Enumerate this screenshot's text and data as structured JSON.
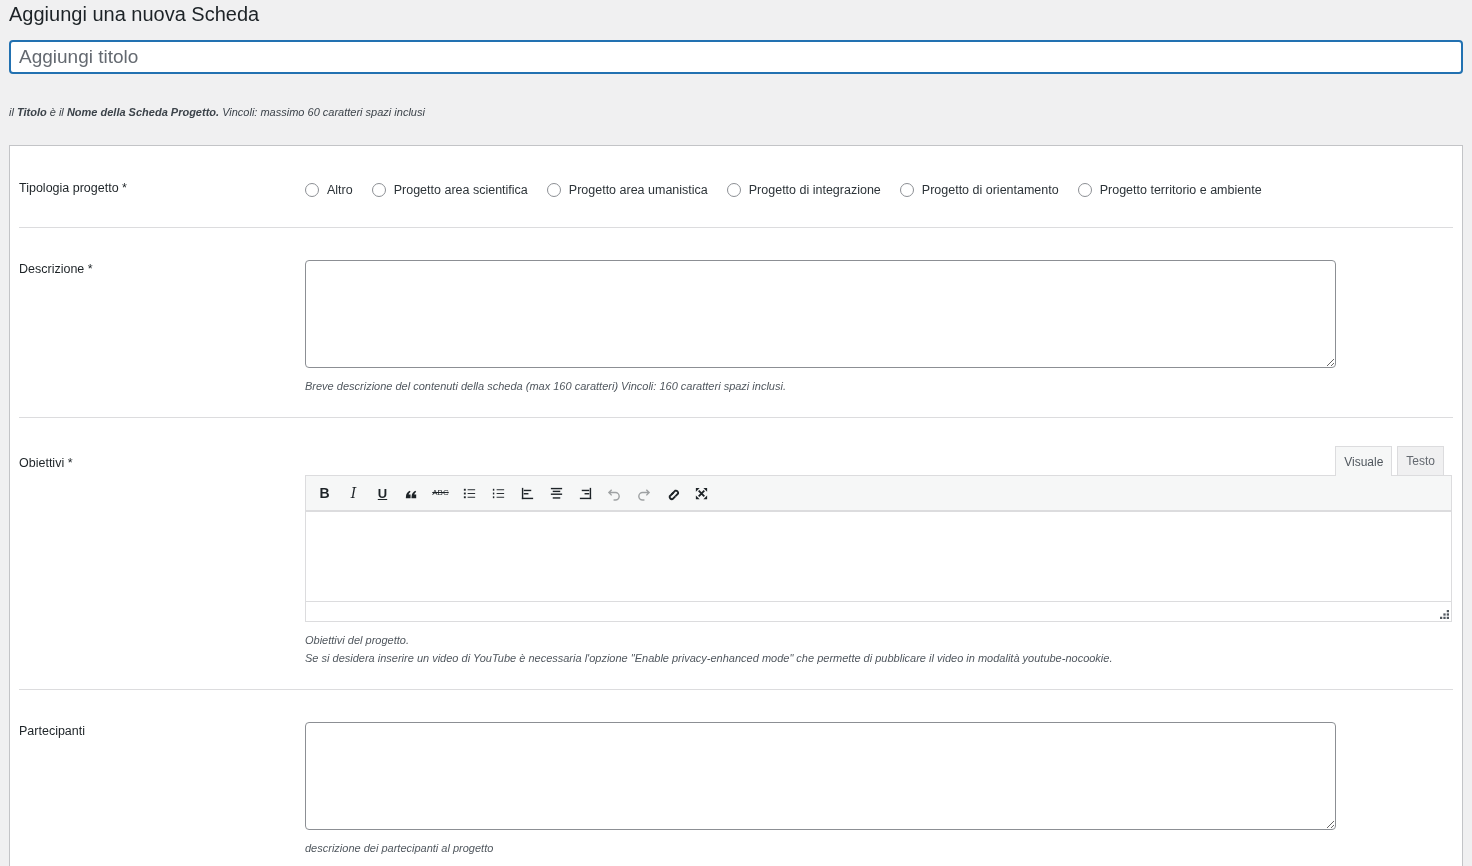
{
  "page_title": "Aggiungi una nuova Scheda",
  "title_field": {
    "placeholder": "Aggiungi titolo",
    "focused": true
  },
  "title_hint": "il **Titolo** è il **Nome della Scheda Progetto.** Vincoli: massimo 60 caratteri spazi inclusi",
  "fields": [
    {
      "kind": "radio",
      "label": "Tipologia progetto *",
      "options": [
        {
          "label": "Altro",
          "selected": false
        },
        {
          "label": "Progetto area scientifica",
          "selected": false
        },
        {
          "label": "Progetto area umanistica",
          "selected": false
        },
        {
          "label": "Progetto di integrazione",
          "selected": false
        },
        {
          "label": "Progetto di orientamento",
          "selected": false
        },
        {
          "label": "Progetto territorio e ambiente",
          "selected": false
        }
      ]
    },
    {
      "kind": "textarea",
      "label": "Descrizione *",
      "help": [
        "Breve descrizione del contenuti della scheda (max 160 caratteri) Vincoli: 160 caratteri spazi inclusi."
      ]
    },
    {
      "kind": "editor",
      "label": "Obiettivi *",
      "tabs": [
        {
          "label": "Visuale",
          "selected": true
        },
        {
          "label": "Testo",
          "selected": false
        }
      ],
      "toolbar": [
        {
          "kind": "bold",
          "label": "B",
          "disabled": false
        },
        {
          "kind": "italic",
          "label": "I",
          "disabled": false
        },
        {
          "kind": "underline",
          "label": "U",
          "disabled": false
        },
        {
          "kind": "quote",
          "disabled": false
        },
        {
          "kind": "strike",
          "label": "ABC",
          "disabled": false
        },
        {
          "kind": "bullets",
          "disabled": false
        },
        {
          "kind": "numbers",
          "disabled": false
        },
        {
          "kind": "align-left",
          "disabled": false
        },
        {
          "kind": "align-center",
          "disabled": false
        },
        {
          "kind": "align-right",
          "disabled": false
        },
        {
          "kind": "undo",
          "disabled": true
        },
        {
          "kind": "redo",
          "disabled": true
        },
        {
          "kind": "link",
          "disabled": false
        },
        {
          "kind": "fullscreen",
          "disabled": false
        }
      ],
      "help": [
        "Obiettivi del progetto.",
        "Se si desidera inserire un video di YouTube è necessaria l'opzione \"Enable privacy-enhanced mode\" che permette di pubblicare il video in modalità youtube-nocookie."
      ]
    },
    {
      "kind": "textarea",
      "label": "Partecipanti",
      "help": [
        "descrizione dei partecipanti al progetto"
      ]
    }
  ]
}
